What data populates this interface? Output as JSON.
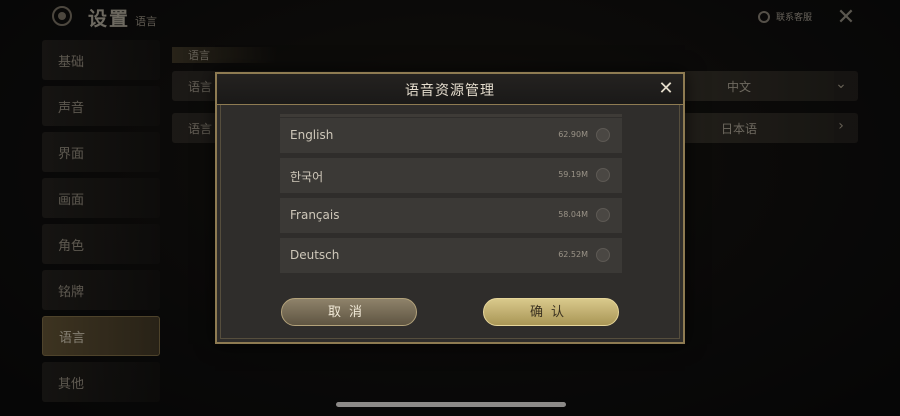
{
  "header": {
    "title": "设置",
    "subtitle": "语言",
    "support_label": "联系客服"
  },
  "sidebar": {
    "items": [
      {
        "label": "基础"
      },
      {
        "label": "声音"
      },
      {
        "label": "界面"
      },
      {
        "label": "画面"
      },
      {
        "label": "角色"
      },
      {
        "label": "铭牌"
      },
      {
        "label": "语言",
        "active": true
      },
      {
        "label": "其他"
      }
    ]
  },
  "content": {
    "section_label": "语言",
    "rows": [
      {
        "label": "语言",
        "value": "中文",
        "icon": "chevron-down-icon"
      },
      {
        "label": "语言",
        "value": "日本语",
        "icon": "chevron-right-icon"
      }
    ]
  },
  "modal": {
    "title": "语音资源管理",
    "items": [
      {
        "name": "English",
        "size": "62.90M"
      },
      {
        "name": "한국어",
        "size": "59.19M"
      },
      {
        "name": "Français",
        "size": "58.04M"
      },
      {
        "name": "Deutsch",
        "size": "62.52M"
      }
    ],
    "cancel_label": "取消",
    "confirm_label": "确认"
  },
  "colors": {
    "accent_gold": "#d9c98b",
    "border_gold": "#8e7b52"
  }
}
